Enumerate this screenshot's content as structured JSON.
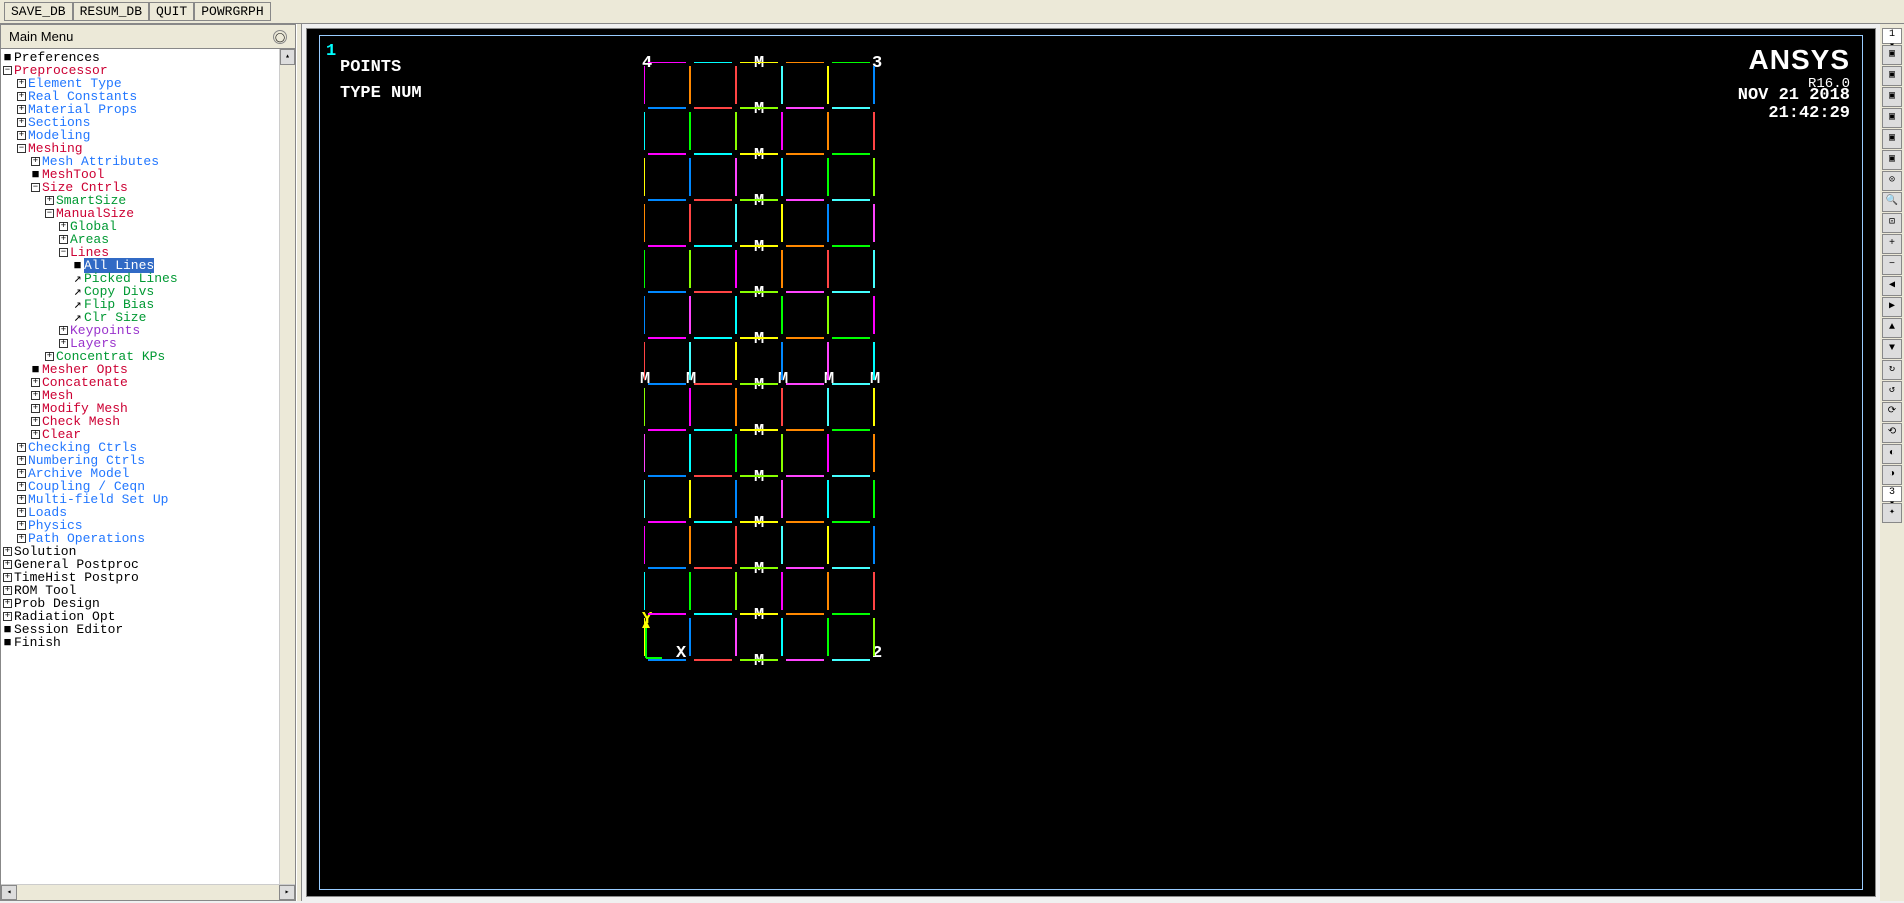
{
  "toolbar": {
    "save_db": "SAVE_DB",
    "resum_db": "RESUM_DB",
    "quit": "QUIT",
    "powrgrph": "POWRGRPH"
  },
  "sidebar": {
    "title": "Main Menu",
    "tree": [
      {
        "indent": 0,
        "box": "■",
        "color": "c-black",
        "text": "Preferences"
      },
      {
        "indent": 0,
        "box": "−",
        "color": "c-red",
        "text": "Preprocessor"
      },
      {
        "indent": 1,
        "box": "+",
        "color": "c-blue",
        "text": "Element Type"
      },
      {
        "indent": 1,
        "box": "+",
        "color": "c-blue",
        "text": "Real Constants"
      },
      {
        "indent": 1,
        "box": "+",
        "color": "c-blue",
        "text": "Material Props"
      },
      {
        "indent": 1,
        "box": "+",
        "color": "c-blue",
        "text": "Sections"
      },
      {
        "indent": 1,
        "box": "+",
        "color": "c-blue",
        "text": "Modeling"
      },
      {
        "indent": 1,
        "box": "−",
        "color": "c-red",
        "text": "Meshing"
      },
      {
        "indent": 2,
        "box": "+",
        "color": "c-blue",
        "text": "Mesh Attributes"
      },
      {
        "indent": 2,
        "box": "■",
        "color": "c-red",
        "text": "MeshTool"
      },
      {
        "indent": 2,
        "box": "−",
        "color": "c-red",
        "text": "Size Cntrls"
      },
      {
        "indent": 3,
        "box": "+",
        "color": "c-green",
        "text": "SmartSize"
      },
      {
        "indent": 3,
        "box": "−",
        "color": "c-red",
        "text": "ManualSize"
      },
      {
        "indent": 4,
        "box": "+",
        "color": "c-green",
        "text": "Global"
      },
      {
        "indent": 4,
        "box": "+",
        "color": "c-green",
        "text": "Areas"
      },
      {
        "indent": 4,
        "box": "−",
        "color": "c-red",
        "text": "Lines"
      },
      {
        "indent": 5,
        "box": "■",
        "color": "c-black",
        "text": "All Lines",
        "selected": true
      },
      {
        "indent": 5,
        "box": "↗",
        "color": "c-green",
        "text": "Picked Lines"
      },
      {
        "indent": 5,
        "box": "↗",
        "color": "c-green",
        "text": "Copy Divs"
      },
      {
        "indent": 5,
        "box": "↗",
        "color": "c-green",
        "text": "Flip Bias"
      },
      {
        "indent": 5,
        "box": "↗",
        "color": "c-green",
        "text": "Clr Size"
      },
      {
        "indent": 4,
        "box": "+",
        "color": "c-purple",
        "text": "Keypoints"
      },
      {
        "indent": 4,
        "box": "+",
        "color": "c-purple",
        "text": "Layers"
      },
      {
        "indent": 3,
        "box": "+",
        "color": "c-green",
        "text": "Concentrat KPs"
      },
      {
        "indent": 2,
        "box": "■",
        "color": "c-red",
        "text": "Mesher Opts"
      },
      {
        "indent": 2,
        "box": "+",
        "color": "c-red",
        "text": "Concatenate"
      },
      {
        "indent": 2,
        "box": "+",
        "color": "c-red",
        "text": "Mesh"
      },
      {
        "indent": 2,
        "box": "+",
        "color": "c-red",
        "text": "Modify Mesh"
      },
      {
        "indent": 2,
        "box": "+",
        "color": "c-red",
        "text": "Check Mesh"
      },
      {
        "indent": 2,
        "box": "+",
        "color": "c-red",
        "text": "Clear"
      },
      {
        "indent": 1,
        "box": "+",
        "color": "c-blue",
        "text": "Checking Ctrls"
      },
      {
        "indent": 1,
        "box": "+",
        "color": "c-blue",
        "text": "Numbering Ctrls"
      },
      {
        "indent": 1,
        "box": "+",
        "color": "c-blue",
        "text": "Archive Model"
      },
      {
        "indent": 1,
        "box": "+",
        "color": "c-blue",
        "text": "Coupling / Ceqn"
      },
      {
        "indent": 1,
        "box": "+",
        "color": "c-blue",
        "text": "Multi-field Set Up"
      },
      {
        "indent": 1,
        "box": "+",
        "color": "c-blue",
        "text": "Loads"
      },
      {
        "indent": 1,
        "box": "+",
        "color": "c-blue",
        "text": "Physics"
      },
      {
        "indent": 1,
        "box": "+",
        "color": "c-blue",
        "text": "Path Operations"
      },
      {
        "indent": 0,
        "box": "+",
        "color": "c-black",
        "text": "Solution"
      },
      {
        "indent": 0,
        "box": "+",
        "color": "c-black",
        "text": "General Postproc"
      },
      {
        "indent": 0,
        "box": "+",
        "color": "c-black",
        "text": "TimeHist Postpro"
      },
      {
        "indent": 0,
        "box": "+",
        "color": "c-black",
        "text": "ROM Tool"
      },
      {
        "indent": 0,
        "box": "+",
        "color": "c-black",
        "text": "Prob Design"
      },
      {
        "indent": 0,
        "box": "+",
        "color": "c-black",
        "text": "Radiation Opt"
      },
      {
        "indent": 0,
        "box": "■",
        "color": "c-black",
        "text": "Session Editor"
      },
      {
        "indent": 0,
        "box": "■",
        "color": "c-black",
        "text": "Finish"
      }
    ]
  },
  "canvas": {
    "window_num": "1",
    "label1": "POINTS",
    "label2": "TYPE NUM",
    "brand": "ANSYS",
    "version": "R16.0",
    "date": "NOV 21 2018",
    "time": "21:42:29",
    "kp": {
      "tl": "4",
      "tr": "3",
      "br": "2"
    },
    "axis_y": "Y",
    "axis_x": "X",
    "m_label": "M"
  },
  "right_toolbar": {
    "sel1": "1 ▾",
    "sel2": "3 ▾"
  }
}
